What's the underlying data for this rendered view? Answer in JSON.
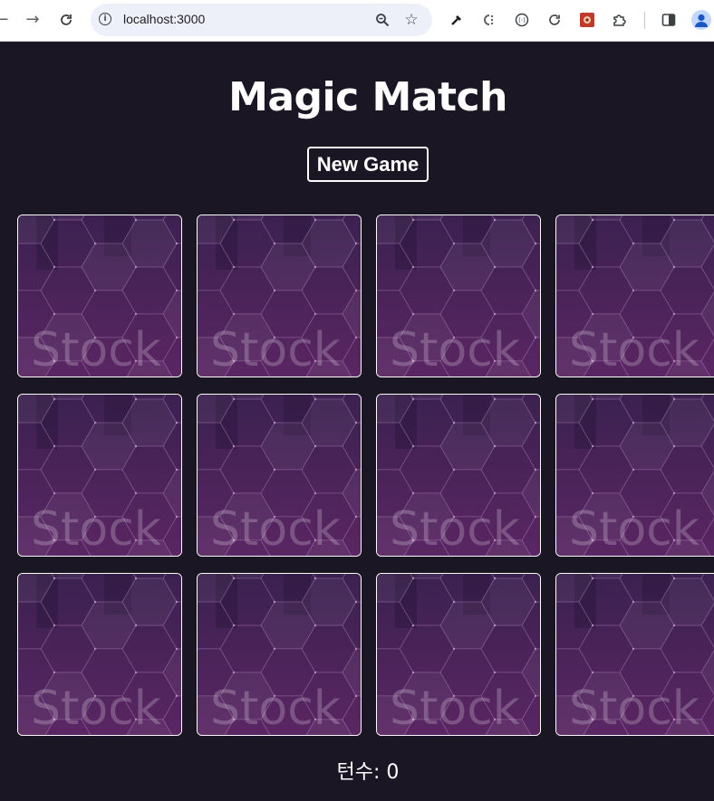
{
  "browser": {
    "url": "localhost:3000",
    "icons": [
      "back-icon",
      "forward-icon",
      "reload-icon",
      "info-icon",
      "zoom-icon",
      "star-icon",
      "eyedropper-icon",
      "extension-icon",
      "extension-icon",
      "reload-icon",
      "extension-icon",
      "puzzle-icon",
      "sidebar-icon",
      "profile-icon"
    ]
  },
  "game": {
    "title": "Magic Match",
    "new_game_label": "New Game",
    "card_back_text": "Stock",
    "card_count": 12,
    "turns_label": "턴수: 0"
  },
  "colors": {
    "page_bg": "#1b1623",
    "card_bg_top": "#3b2150",
    "card_bg_bottom": "#5a2663",
    "card_border": "#ffffff"
  }
}
